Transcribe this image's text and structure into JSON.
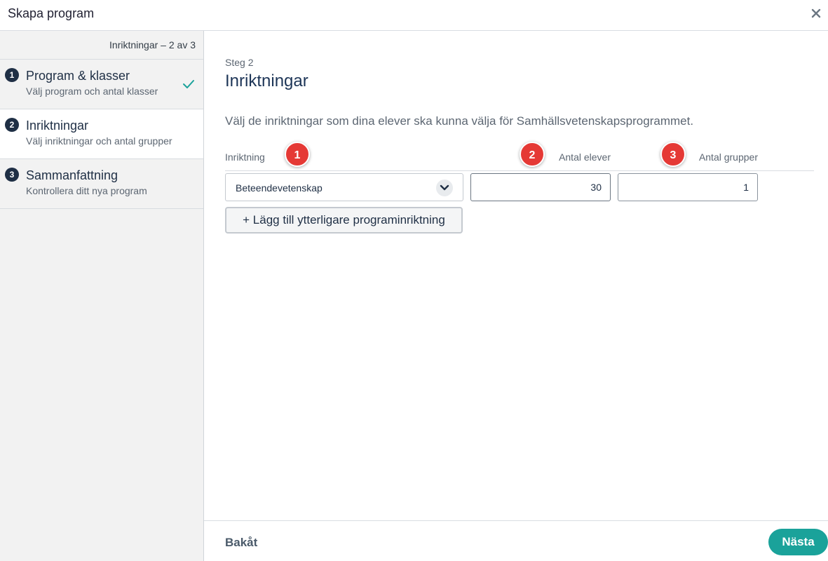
{
  "window": {
    "title": "Skapa program",
    "close_icon": "close-icon"
  },
  "sidebar": {
    "progress": "Inriktningar – 2 av 3",
    "steps": [
      {
        "number": "1",
        "title": "Program & klasser",
        "subtitle": "Välj program och antal klasser",
        "completed": true
      },
      {
        "number": "2",
        "title": "Inriktningar",
        "subtitle": "Välj inriktningar och antal grupper",
        "active": true
      },
      {
        "number": "3",
        "title": "Sammanfattning",
        "subtitle": "Kontrollera ditt nya program"
      }
    ]
  },
  "main": {
    "eyebrow": "Steg 2",
    "heading": "Inriktningar",
    "description": "Välj de inriktningar som dina elever ska kunna välja för Samhällsvetenskapsprogrammet.",
    "columns": {
      "inriktning": "Inriktning",
      "antal_elever": "Antal elever",
      "antal_grupper": "Antal grupper"
    },
    "badges": [
      "1",
      "2",
      "3"
    ],
    "row": {
      "inriktning": "Beteendevetenskap",
      "antal_elever": "30",
      "antal_grupper": "1"
    },
    "add_button": "+ Lägg till ytterligare programinriktning"
  },
  "footer": {
    "back": "Bakåt",
    "next": "Nästa"
  },
  "colors": {
    "accent": "#1aa29a",
    "badge": "#e53935",
    "navy": "#1f2f45"
  }
}
